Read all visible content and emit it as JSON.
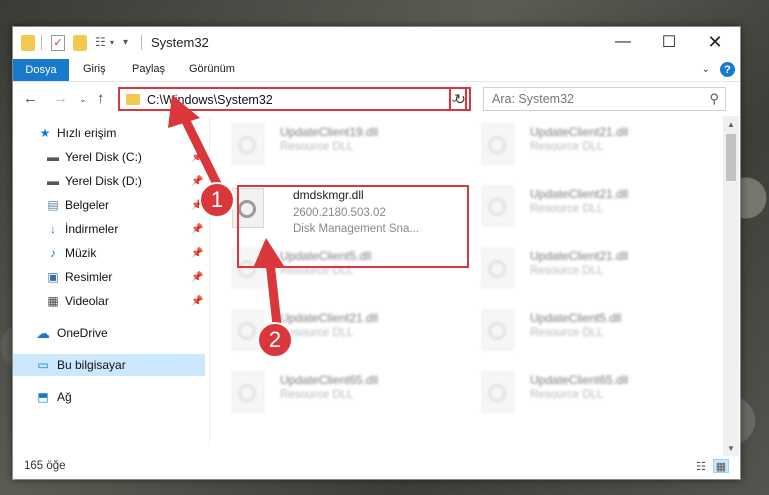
{
  "window": {
    "title": "System32"
  },
  "ribbon": {
    "tabs": [
      {
        "label": "Dosya"
      },
      {
        "label": "Giriş"
      },
      {
        "label": "Paylaş"
      },
      {
        "label": "Görünüm"
      }
    ],
    "help": "?"
  },
  "address": {
    "path": "C:\\Windows\\System32",
    "search_placeholder": "Ara: System32"
  },
  "sidebar": {
    "items": [
      {
        "label": "Hızlı erişim"
      },
      {
        "label": "Yerel Disk (C:)"
      },
      {
        "label": "Yerel Disk (D:)"
      },
      {
        "label": "Belgeler"
      },
      {
        "label": "İndirmeler"
      },
      {
        "label": "Müzik"
      },
      {
        "label": "Resimler"
      },
      {
        "label": "Videolar"
      },
      {
        "label": "OneDrive"
      },
      {
        "label": "Bu bilgisayar"
      },
      {
        "label": "Ağ"
      }
    ]
  },
  "files": [
    {
      "name": "UpdateClient19.dll",
      "line2": "Resource DLL",
      "line3": ""
    },
    {
      "name": "UpdateClient21.dll",
      "line2": "Resource DLL",
      "line3": ""
    },
    {
      "name": "dmdskmgr.dll",
      "line2": "2600.2180.503.02",
      "line3": "Disk Management Sna..."
    },
    {
      "name": "UpdateClient21.dll",
      "line2": "Resource DLL",
      "line3": ""
    },
    {
      "name": "UpdateClient5.dll",
      "line2": "Resource DLL",
      "line3": ""
    },
    {
      "name": "UpdateClient21.dll",
      "line2": "Resource DLL",
      "line3": ""
    },
    {
      "name": "UpdateClient21.dll",
      "line2": "Resource DLL",
      "line3": ""
    },
    {
      "name": "UpdateClient5.dll",
      "line2": "Resource DLL",
      "line3": ""
    },
    {
      "name": "UpdateClient65.dll",
      "line2": "Resource DLL",
      "line3": ""
    },
    {
      "name": "UpdateClient65.dll",
      "line2": "Resource DLL",
      "line3": ""
    }
  ],
  "status": {
    "count": "165 öğe"
  },
  "annotations": {
    "step1": "1",
    "step2": "2"
  },
  "colors": {
    "accent": "#1979ca",
    "highlight_red": "#d9373b",
    "selected_bg": "#cce8ff"
  }
}
